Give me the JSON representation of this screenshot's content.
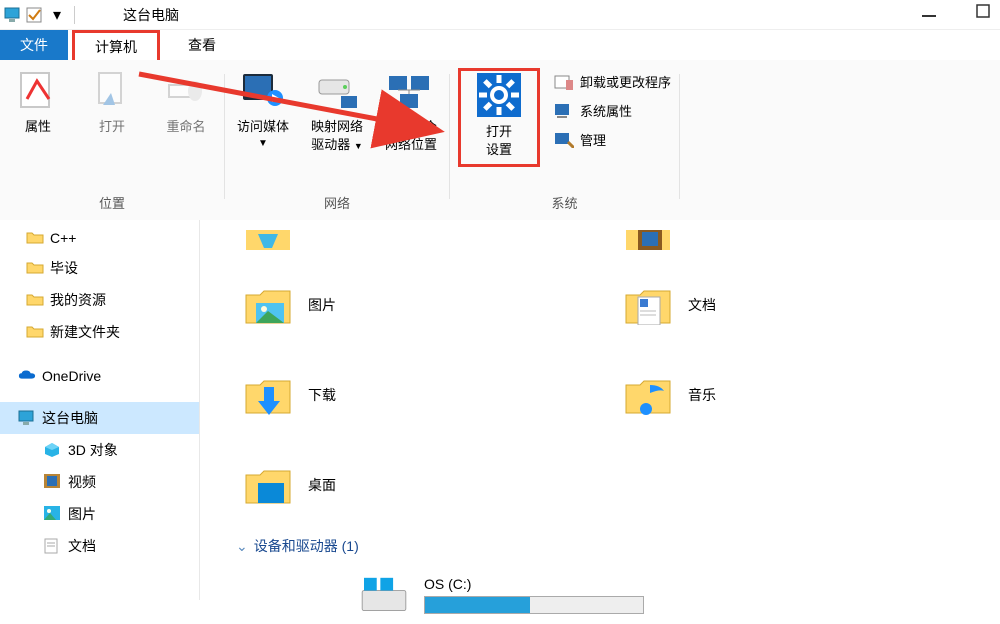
{
  "title": "这台电脑",
  "tabs": {
    "file": "文件",
    "computer": "计算机",
    "view": "查看"
  },
  "ribbon": {
    "location": {
      "label": "位置",
      "properties": "属性",
      "open": "打开",
      "rename": "重命名"
    },
    "network": {
      "label": "网络",
      "access_media": "访问媒体",
      "map_drive_l1": "映射网络",
      "map_drive_l2": "驱动器",
      "add_loc_l1": "添加一个",
      "add_loc_l2": "网络位置"
    },
    "system": {
      "label": "系统",
      "open_settings_l1": "打开",
      "open_settings_l2": "设置",
      "uninstall": "卸载或更改程序",
      "sys_props": "系统属性",
      "manage": "管理"
    }
  },
  "nav": {
    "folders": [
      "C++",
      "毕设",
      "我的资源",
      "新建文件夹"
    ],
    "onedrive": "OneDrive",
    "this_pc": "这台电脑",
    "pc_children": [
      "3D 对象",
      "视频",
      "图片",
      "文档"
    ]
  },
  "content": {
    "items": [
      "图片",
      "文档",
      "下载",
      "音乐",
      "桌面"
    ],
    "section_header": "设备和驱动器 (1)",
    "drive_label": "OS (C:)"
  },
  "capacity_percent": 48
}
